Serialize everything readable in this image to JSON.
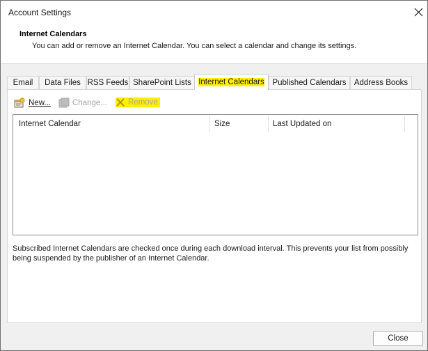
{
  "window": {
    "title": "Account Settings"
  },
  "header": {
    "title": "Internet Calendars",
    "description": "You can add or remove an Internet Calendar. You can select a calendar and change its settings."
  },
  "tabs": [
    {
      "label": "Email"
    },
    {
      "label": "Data Files"
    },
    {
      "label": "RSS Feeds"
    },
    {
      "label": "SharePoint Lists"
    },
    {
      "label": "Internet Calendars",
      "active": true
    },
    {
      "label": "Published Calendars"
    },
    {
      "label": "Address Books"
    }
  ],
  "toolbar": {
    "new_label": "New...",
    "change_label": "Change...",
    "remove_label": "Remove"
  },
  "list": {
    "columns": [
      "Internet Calendar",
      "Size",
      "Last Updated on"
    ],
    "rows": []
  },
  "notice": "Subscribed Internet Calendars are checked once during each download interval. This prevents your list from possibly being suspended by the publisher of an Internet Calendar.",
  "footer": {
    "close_label": "Close"
  },
  "colors": {
    "highlight": "#fff000",
    "disabled_text": "#a3a3a3",
    "body_bg": "#f0f0f0"
  }
}
